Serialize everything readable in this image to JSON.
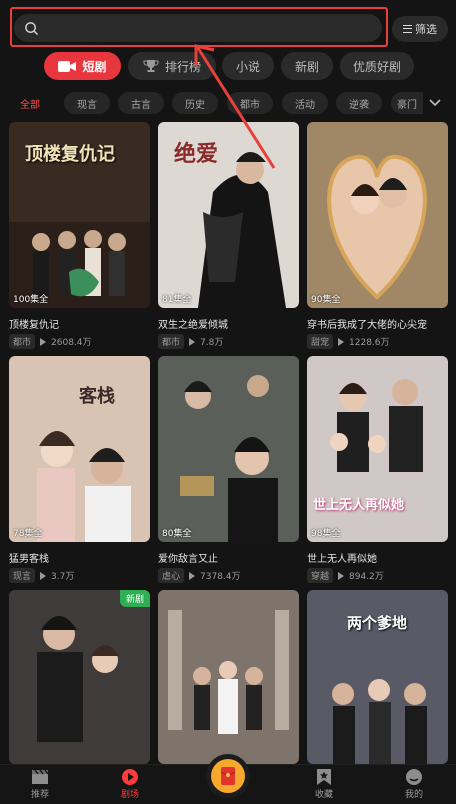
{
  "search": {
    "placeholder": ""
  },
  "filter": {
    "label": "筛选"
  },
  "main_tabs": [
    {
      "label": "短剧",
      "icon": "video-icon",
      "active": true
    },
    {
      "label": "排行榜",
      "icon": "trophy-icon"
    },
    {
      "label": "小说"
    },
    {
      "label": "新剧"
    },
    {
      "label": "优质好剧"
    }
  ],
  "genres": [
    "全部",
    "现言",
    "古言",
    "历史",
    "都市",
    "活动",
    "逆袭",
    "豪门"
  ],
  "cards": [
    {
      "title": "顶楼复仇记",
      "episodes": "100集全",
      "tag": "都市",
      "views": "2608.4万",
      "poster_text": "顶楼复仇记",
      "bg": "#3a2b22"
    },
    {
      "title": "双生之绝爱倾城",
      "episodes": "81集全",
      "tag": "都市",
      "views": "7.8万",
      "poster_text": "绝爱",
      "bg": "#ddd9d2"
    },
    {
      "title": "穿书后我成了大佬的心尖宠",
      "episodes": "90集全",
      "tag": "甜宠",
      "views": "1228.6万",
      "poster_text": "",
      "bg": "#a08866"
    },
    {
      "title": "猛男客栈",
      "episodes": "78集全",
      "tag": "现言",
      "views": "3.7万",
      "poster_text": "客栈",
      "bg": "#d9c3b2"
    },
    {
      "title": "爱你敌言又止",
      "episodes": "80集全",
      "tag": "虐心",
      "views": "7378.4万",
      "poster_text": "",
      "bg": "#5b5f5a"
    },
    {
      "title": "世上无人再似她",
      "episodes": "98集全",
      "tag": "穿越",
      "views": "894.2万",
      "poster_text": "世上无人再似她",
      "bg": "#cfc8c6"
    },
    {
      "title": "",
      "episodes": "",
      "tag": "",
      "views": "",
      "poster_text": "",
      "badge": "新剧",
      "bg": "#3e3b3a"
    },
    {
      "title": "",
      "episodes": "",
      "tag": "",
      "views": "",
      "poster_text": "",
      "bg": "#7f746b"
    },
    {
      "title": "",
      "episodes": "",
      "tag": "",
      "views": "",
      "poster_text": "两个爹地",
      "bg": "#5a5a66"
    }
  ],
  "bottom_nav": [
    {
      "label": "推荐",
      "icon": "clapperboard-icon"
    },
    {
      "label": "剧场",
      "icon": "play-circle-icon",
      "active": true
    },
    {
      "label": "",
      "icon": "red-envelope-icon"
    },
    {
      "label": "收藏",
      "icon": "bookmark-star-icon"
    },
    {
      "label": "我的",
      "icon": "profile-icon"
    }
  ],
  "colors": {
    "accent": "#e7363e",
    "annotation": "#e8413c",
    "new_badge": "#2fae53"
  }
}
